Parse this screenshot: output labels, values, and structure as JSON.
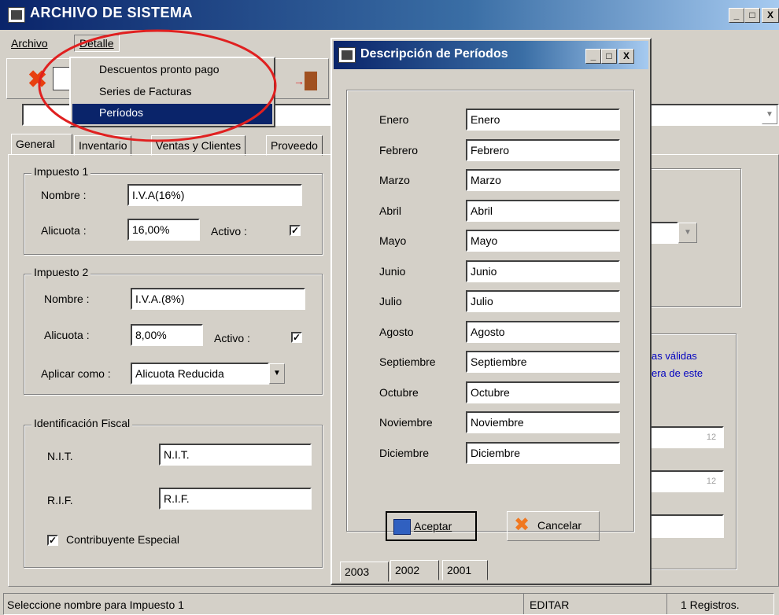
{
  "window": {
    "title": "ARCHIVO DE SISTEMA",
    "min": "_",
    "max": "□",
    "close": "X"
  },
  "menubar": {
    "archivo": "Archivo",
    "detalle": "Detalle"
  },
  "dropdown": {
    "items": [
      "Descuentos pronto pago",
      "Series de Facturas",
      "Períodos"
    ]
  },
  "tabs": [
    "General",
    "Inventario",
    "Ventas y Clientes",
    "Proveedo"
  ],
  "impuesto1": {
    "legend": "Impuesto 1",
    "nombre_label": "Nombre :",
    "nombre": "I.V.A(16%)",
    "alicuota_label": "Alicuota :",
    "alicuota": "16,00%",
    "activo_label": "Activo :",
    "activo": "✓"
  },
  "impuesto2": {
    "legend": "Impuesto 2",
    "nombre_label": "Nombre :",
    "nombre": "I.V.A.(8%)",
    "alicuota_label": "Alicuota :",
    "alicuota": "8,00%",
    "activo_label": "Activo :",
    "activo": "✓",
    "aplicar_label": "Aplicar como :",
    "aplicar": "Alicuota Reducida"
  },
  "fiscal": {
    "legend": "Identificación Fiscal",
    "nit_label": "N.I.T.",
    "nit": "N.I.T.",
    "rif_label": "R.I.F.",
    "rif": "R.I.F.",
    "especial_label": "Contribuyente Especial",
    "especial": "✓"
  },
  "background_text": {
    "line1": "as válidas",
    "line2": "era de este"
  },
  "dialog": {
    "title": "Descripción de Períodos",
    "months": [
      {
        "label": "Enero",
        "value": "Enero"
      },
      {
        "label": "Febrero",
        "value": "Febrero"
      },
      {
        "label": "Marzo",
        "value": "Marzo"
      },
      {
        "label": "Abril",
        "value": "Abril"
      },
      {
        "label": "Mayo",
        "value": "Mayo"
      },
      {
        "label": "Junio",
        "value": "Junio"
      },
      {
        "label": "Julio",
        "value": "Julio"
      },
      {
        "label": "Agosto",
        "value": "Agosto"
      },
      {
        "label": "Septiembre",
        "value": "Septiembre"
      },
      {
        "label": "Octubre",
        "value": "Octubre"
      },
      {
        "label": "Noviembre",
        "value": "Noviembre"
      },
      {
        "label": "Diciembre",
        "value": "Diciembre"
      }
    ],
    "aceptar": "Aceptar",
    "cancelar": "Cancelar",
    "years": [
      "2003",
      "2002",
      "2001"
    ]
  },
  "status": {
    "message": "Seleccione nombre para Impuesto 1",
    "mode": "EDITAR",
    "records": "1 Registros."
  },
  "colors": {
    "title_start": "#0a246a",
    "title_end": "#a6caf0",
    "highlight": "#0a246a",
    "annotation": "#e02020",
    "link_text": "#0000c0"
  }
}
